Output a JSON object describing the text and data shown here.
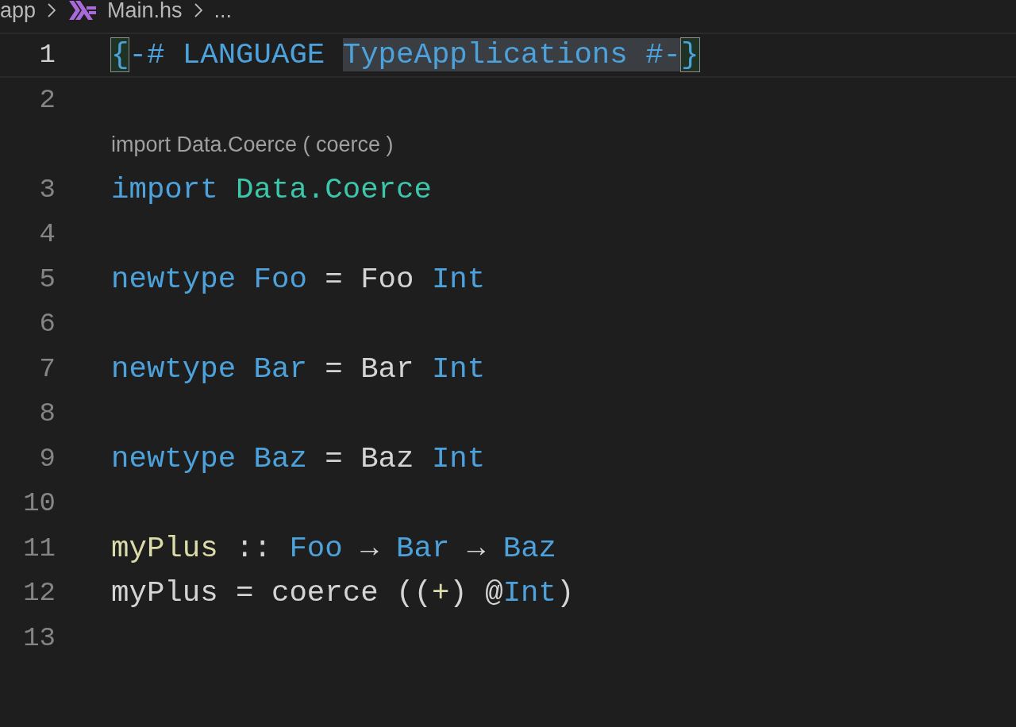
{
  "breadcrumb": [
    {
      "kind": "folder",
      "label": "app"
    },
    {
      "kind": "file",
      "label": "Main.hs"
    },
    {
      "kind": "more",
      "label": "..."
    }
  ],
  "lines": [
    {
      "kind": "code",
      "number": "1",
      "active": true,
      "tokens": [
        {
          "kind": "bracket",
          "text": "{",
          "selected": false
        },
        {
          "kind": "pragma",
          "text": "-# LANGUAGE ",
          "selected": false
        },
        {
          "kind": "pragma",
          "text": "TypeApplications #-",
          "selected": true
        },
        {
          "kind": "bracket",
          "text": "}",
          "selected": false
        }
      ]
    },
    {
      "kind": "code",
      "number": "2",
      "active": false
    },
    {
      "kind": "codelens",
      "text": "import Data.Coerce ( coerce )"
    },
    {
      "kind": "code",
      "number": "3",
      "active": false,
      "tokens": [
        {
          "kind": "keyword",
          "text": "import "
        },
        {
          "kind": "module",
          "text": "Data.Coerce"
        }
      ]
    },
    {
      "kind": "code",
      "number": "4",
      "active": false
    },
    {
      "kind": "code",
      "number": "5",
      "active": false,
      "tokens": [
        {
          "kind": "keyword",
          "text": "newtype "
        },
        {
          "kind": "type",
          "text": "Foo"
        },
        {
          "kind": "plain",
          "text": " = Foo "
        },
        {
          "kind": "type",
          "text": "Int"
        }
      ]
    },
    {
      "kind": "code",
      "number": "6",
      "active": false
    },
    {
      "kind": "code",
      "number": "7",
      "active": false,
      "tokens": [
        {
          "kind": "keyword",
          "text": "newtype "
        },
        {
          "kind": "type",
          "text": "Bar"
        },
        {
          "kind": "plain",
          "text": " = Bar "
        },
        {
          "kind": "type",
          "text": "Int"
        }
      ]
    },
    {
      "kind": "code",
      "number": "8",
      "active": false
    },
    {
      "kind": "code",
      "number": "9",
      "active": false,
      "tokens": [
        {
          "kind": "keyword",
          "text": "newtype "
        },
        {
          "kind": "type",
          "text": "Baz"
        },
        {
          "kind": "plain",
          "text": " = Baz "
        },
        {
          "kind": "type",
          "text": "Int"
        }
      ]
    },
    {
      "kind": "code",
      "number": "10",
      "active": false
    },
    {
      "kind": "code",
      "number": "11",
      "active": false,
      "tokens": [
        {
          "kind": "function",
          "text": "myPlus"
        },
        {
          "kind": "plain",
          "text": " :: "
        },
        {
          "kind": "type",
          "text": "Foo"
        },
        {
          "kind": "plain",
          "text": " → "
        },
        {
          "kind": "type",
          "text": "Bar"
        },
        {
          "kind": "plain",
          "text": " → "
        },
        {
          "kind": "type",
          "text": "Baz"
        }
      ]
    },
    {
      "kind": "code",
      "number": "12",
      "active": false,
      "tokens": [
        {
          "kind": "plain",
          "text": "myPlus = coerce (("
        },
        {
          "kind": "operator",
          "text": "+"
        },
        {
          "kind": "plain",
          "text": ") @"
        },
        {
          "kind": "type",
          "text": "Int"
        },
        {
          "kind": "plain",
          "text": ")"
        }
      ]
    },
    {
      "kind": "code",
      "number": "13",
      "active": false
    }
  ]
}
